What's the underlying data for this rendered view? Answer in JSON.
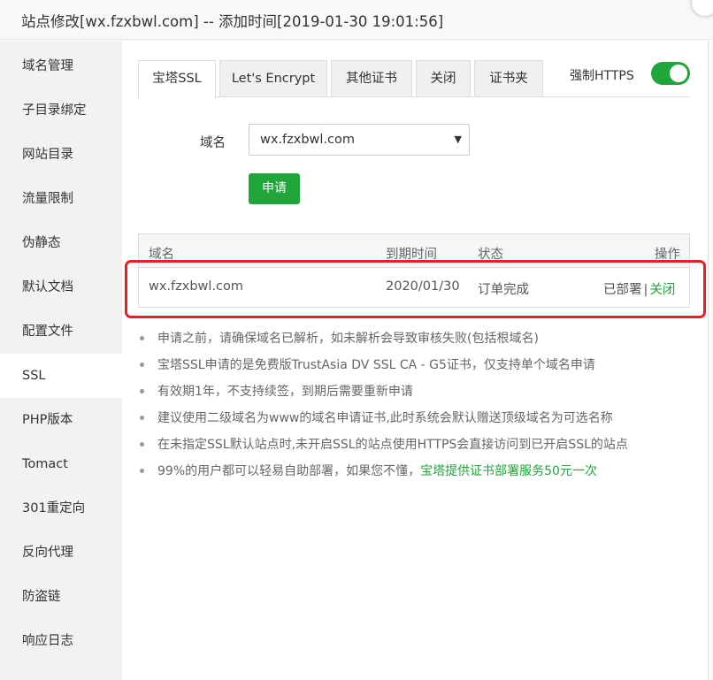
{
  "window": {
    "title": "站点修改[wx.fzxbwl.com] -- 添加时间[2019-01-30 19:01:56]"
  },
  "sidebar": {
    "items": [
      {
        "label": "域名管理",
        "active": false
      },
      {
        "label": "子目录绑定",
        "active": false
      },
      {
        "label": "网站目录",
        "active": false
      },
      {
        "label": "流量限制",
        "active": false
      },
      {
        "label": "伪静态",
        "active": false
      },
      {
        "label": "默认文档",
        "active": false
      },
      {
        "label": "配置文件",
        "active": false
      },
      {
        "label": "SSL",
        "active": true
      },
      {
        "label": "PHP版本",
        "active": false
      },
      {
        "label": "Tomact",
        "active": false
      },
      {
        "label": "301重定向",
        "active": false
      },
      {
        "label": "反向代理",
        "active": false
      },
      {
        "label": "防盗链",
        "active": false
      },
      {
        "label": "响应日志",
        "active": false
      }
    ]
  },
  "tabs": [
    {
      "label": "宝塔SSL",
      "active": true
    },
    {
      "label": "Let's Encrypt",
      "active": false
    },
    {
      "label": "其他证书",
      "active": false
    },
    {
      "label": "关闭",
      "active": false
    },
    {
      "label": "证书夹",
      "active": false
    }
  ],
  "force_https": {
    "label": "强制HTTPS",
    "enabled": true
  },
  "domain_form": {
    "label": "域名",
    "selected": "wx.fzxbwl.com",
    "apply_label": "申请"
  },
  "table": {
    "headers": {
      "domain": "域名",
      "expire": "到期时间",
      "status": "状态",
      "action": "操作"
    },
    "rows": [
      {
        "domain": "wx.fzxbwl.com",
        "expire": "2020/01/30",
        "status": "订单完成",
        "deployed": "已部署",
        "separator": "|",
        "close": "关闭"
      }
    ]
  },
  "notes": {
    "items": [
      "申请之前，请确保域名已解析，如未解析会导致审核失败(包括根域名)",
      "宝塔SSL申请的是免费版TrustAsia DV SSL CA - G5证书，仅支持单个域名申请",
      "有效期1年，不支持续签，到期后需要重新申请",
      "建议使用二级域名为www的域名申请证书,此时系统会默认赠送顶级域名为可选名称",
      "在未指定SSL默认站点时,未开启SSL的站点使用HTTPS会直接访问到已开启SSL的站点"
    ],
    "last_prefix": "99%的用户都可以轻易自助部署，如果您不懂，",
    "last_link": "宝塔提供证书部署服务50元一次"
  },
  "colors": {
    "accent": "#20a53a",
    "highlight": "#e82020"
  }
}
